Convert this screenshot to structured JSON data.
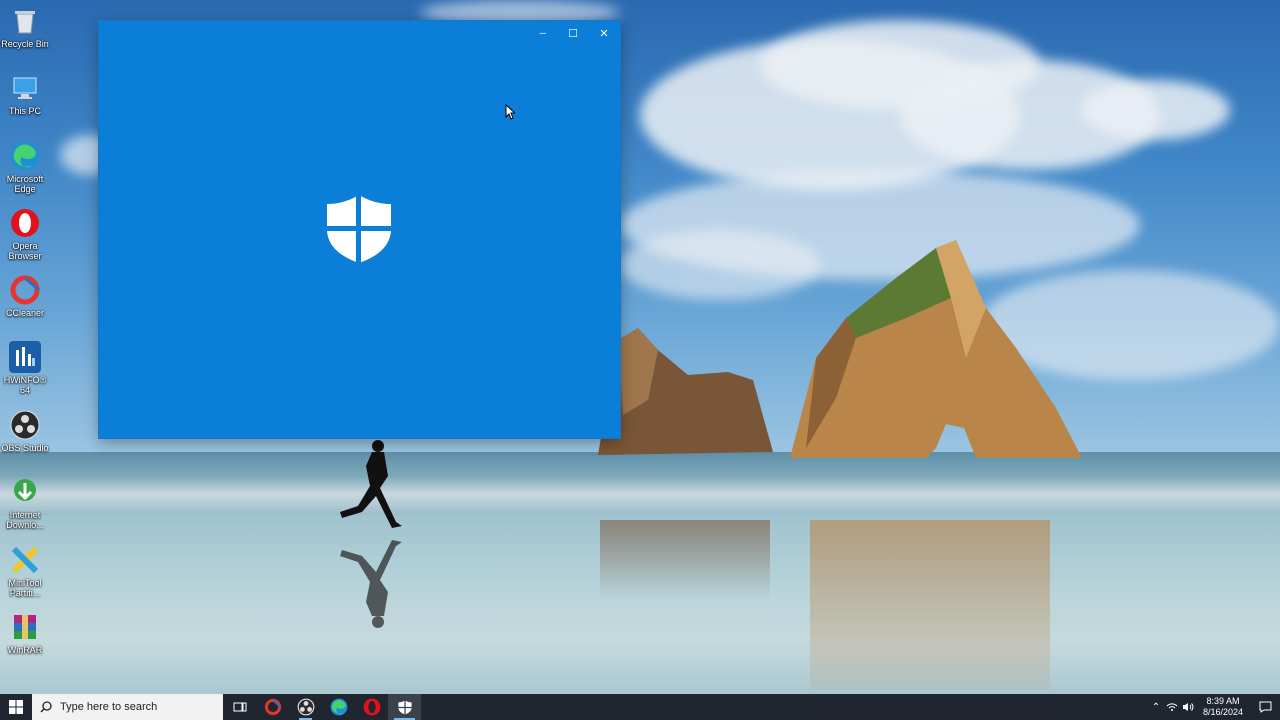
{
  "desktop": {
    "icons": [
      {
        "label": "Recycle Bin",
        "icon": "recycle-bin-icon"
      },
      {
        "label": "This PC",
        "icon": "this-pc-icon"
      },
      {
        "label": "Microsoft Edge",
        "icon": "edge-icon"
      },
      {
        "label": "Opera Browser",
        "icon": "opera-icon"
      },
      {
        "label": "CCleaner",
        "icon": "ccleaner-icon"
      },
      {
        "label": "HWiNFO® 64",
        "icon": "hwinfo-icon"
      },
      {
        "label": "OBS Studio",
        "icon": "obs-icon"
      },
      {
        "label": "Internet Downlo...",
        "icon": "internet-download-manager-icon"
      },
      {
        "label": "MiniTool Partiti...",
        "icon": "minitool-partition-icon"
      },
      {
        "label": "WinRAR",
        "icon": "winrar-icon"
      }
    ]
  },
  "window": {
    "app": "Windows Security",
    "state": "splash",
    "background": "#0b7fd8",
    "controls": {
      "minimize": "─",
      "maximize": "☐",
      "close": "✕"
    }
  },
  "taskbar": {
    "search_placeholder": "Type here to search",
    "apps": [
      {
        "name": "task-view",
        "icon": "task-view-icon"
      },
      {
        "name": "ccleaner",
        "icon": "ccleaner-icon"
      },
      {
        "name": "obs",
        "icon": "obs-icon"
      },
      {
        "name": "edge",
        "icon": "edge-icon"
      },
      {
        "name": "opera",
        "icon": "opera-icon"
      },
      {
        "name": "windows-security",
        "icon": "shield-icon",
        "active": true
      }
    ],
    "clock": {
      "time": "8:39 AM",
      "date": "8/16/2024"
    }
  },
  "colors": {
    "accent": "#0b7fd8",
    "taskbar": "#1f2630",
    "indicator": "#76b9ed"
  }
}
